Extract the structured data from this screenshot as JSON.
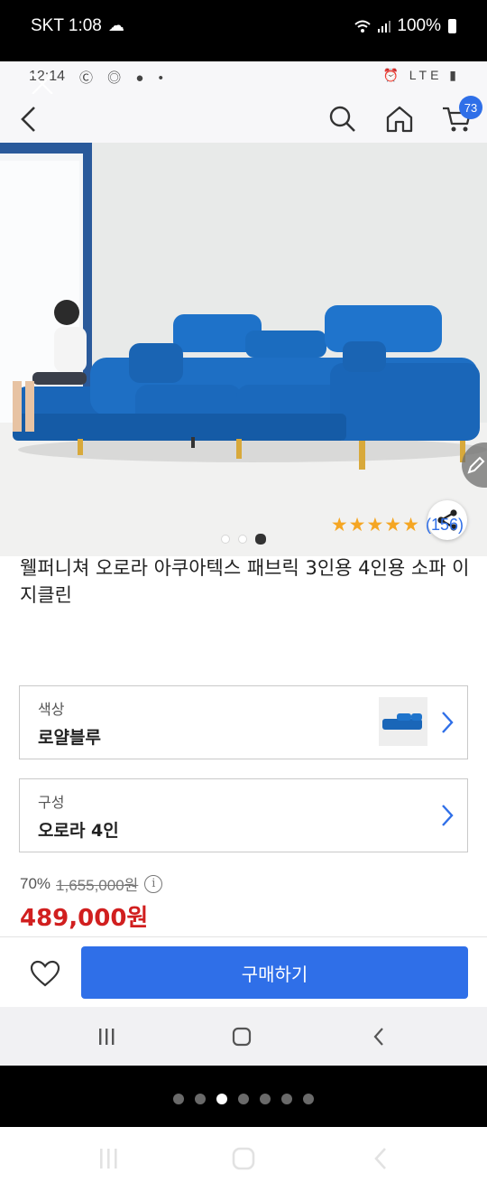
{
  "outer_status": {
    "carrier_time": "SKT 1:08",
    "battery": "100%"
  },
  "inner_status": {
    "time": "12:14",
    "network": "LTE"
  },
  "appbar": {
    "cart_count": "73"
  },
  "gallery": {
    "slide_count": 3,
    "active_slide": 3
  },
  "rating": {
    "stars": "★★★★★",
    "count": "(156)"
  },
  "product": {
    "title": "웰퍼니쳐 오로라 아쿠아텍스 패브릭 3인용 4인용 소파 이지클린"
  },
  "options": [
    {
      "label": "색상",
      "value": "로얄블루"
    },
    {
      "label": "구성",
      "value": "오로라 4인"
    }
  ],
  "price": {
    "discount": "70%",
    "original": "1,655,000원",
    "info": "i",
    "current": "489,000원"
  },
  "bottom": {
    "buy_label": "구매하기"
  },
  "pager": {
    "total": 7,
    "active": 3
  },
  "colors": {
    "accent": "#2f6fe8",
    "price": "#d11f1f",
    "star": "#f5a623",
    "sofa": "#1a66b8"
  }
}
